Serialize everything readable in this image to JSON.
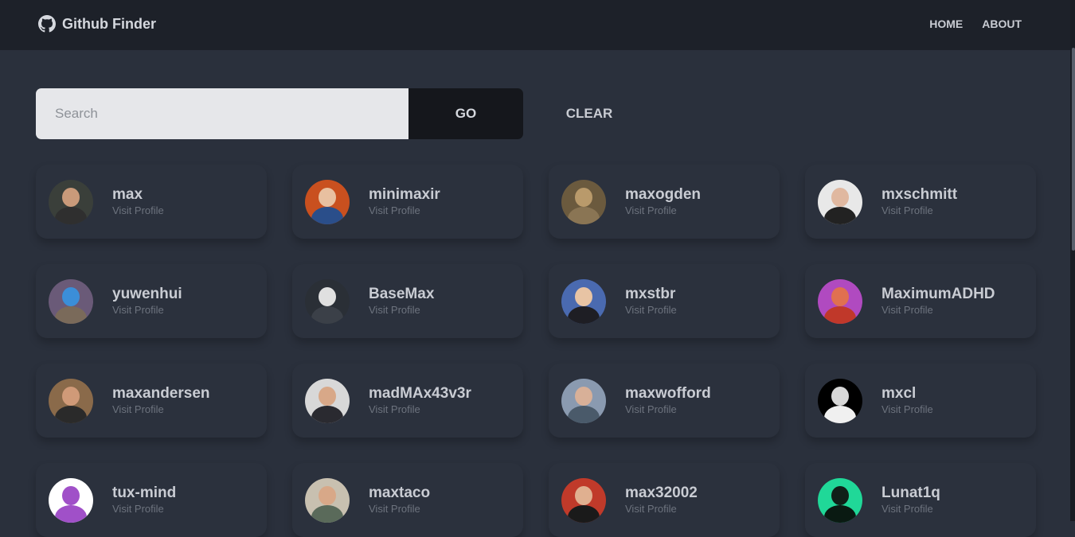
{
  "navbar": {
    "brand_icon": "github-icon",
    "brand_title": "Github Finder",
    "links": [
      "HOME",
      "ABOUT"
    ]
  },
  "search": {
    "placeholder": "Search",
    "value": "",
    "go_label": "GO",
    "clear_label": "CLEAR"
  },
  "users": [
    {
      "login": "max",
      "link_label": "Visit Profile",
      "avatar_colors": [
        "#3a3f3a",
        "#c99a7a",
        "#2f2f2f"
      ]
    },
    {
      "login": "minimaxir",
      "link_label": "Visit Profile",
      "avatar_colors": [
        "#c9501f",
        "#e8c0a0",
        "#2a4e8a"
      ]
    },
    {
      "login": "maxogden",
      "link_label": "Visit Profile",
      "avatar_colors": [
        "#6b5a3e",
        "#b99a6b",
        "#8a7554"
      ]
    },
    {
      "login": "mxschmitt",
      "link_label": "Visit Profile",
      "avatar_colors": [
        "#e8e8e8",
        "#e0b8a0",
        "#222222"
      ]
    },
    {
      "login": "yuwenhui",
      "link_label": "Visit Profile",
      "avatar_colors": [
        "#6a5a78",
        "#3b8ed8",
        "#7a6a5a"
      ]
    },
    {
      "login": "BaseMax",
      "link_label": "Visit Profile",
      "avatar_colors": [
        "#2a2f36",
        "#e0e0e0",
        "#3b4048"
      ]
    },
    {
      "login": "mxstbr",
      "link_label": "Visit Profile",
      "avatar_colors": [
        "#4a6ab0",
        "#e8c4a4",
        "#1e1e24"
      ]
    },
    {
      "login": "MaximumADHD",
      "link_label": "Visit Profile",
      "avatar_colors": [
        "#b04ac0",
        "#e07050",
        "#c0382a"
      ]
    },
    {
      "login": "maxandersen",
      "link_label": "Visit Profile",
      "avatar_colors": [
        "#8a6a4a",
        "#d09a78",
        "#2a2a2a"
      ]
    },
    {
      "login": "madMAx43v3r",
      "link_label": "Visit Profile",
      "avatar_colors": [
        "#d8d8d8",
        "#d8a888",
        "#2a2a30"
      ]
    },
    {
      "login": "maxwofford",
      "link_label": "Visit Profile",
      "avatar_colors": [
        "#8a9ab0",
        "#d8b098",
        "#4a5a6a"
      ]
    },
    {
      "login": "mxcl",
      "link_label": "Visit Profile",
      "avatar_colors": [
        "#000000",
        "#d8d8d8",
        "#f0f0f0"
      ]
    },
    {
      "login": "tux-mind",
      "link_label": "Visit Profile",
      "avatar_colors": [
        "#ffffff",
        "#a050c8",
        "#a050c8"
      ]
    },
    {
      "login": "maxtaco",
      "link_label": "Visit Profile",
      "avatar_colors": [
        "#c8c0b0",
        "#d8a888",
        "#5a6a5a"
      ]
    },
    {
      "login": "max32002",
      "link_label": "Visit Profile",
      "avatar_colors": [
        "#c03a2a",
        "#e0b090",
        "#1a1a1a"
      ]
    },
    {
      "login": "Lunat1q",
      "link_label": "Visit Profile",
      "avatar_colors": [
        "#20d898",
        "#102018",
        "#0a1a12"
      ]
    }
  ]
}
